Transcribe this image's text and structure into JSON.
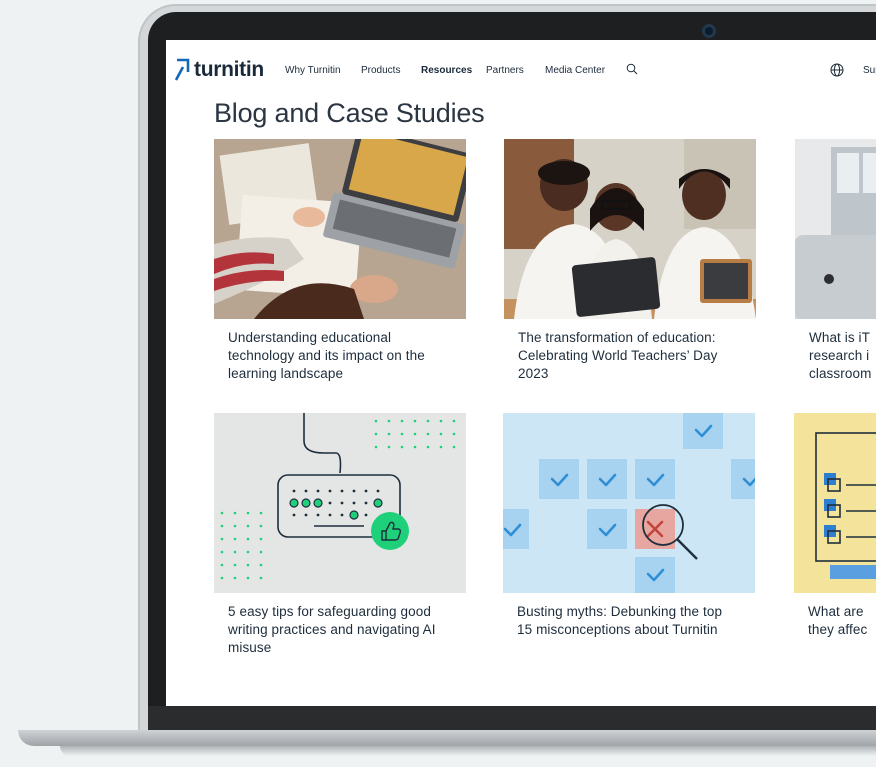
{
  "nav": {
    "logo_text": "turnitin",
    "items": [
      "Why Turnitin",
      "Products",
      "Resources",
      "Partners",
      "Media Center"
    ],
    "active": "Resources",
    "support_label": "Sup"
  },
  "page": {
    "title": "Blog and Case Studies"
  },
  "articles": [
    {
      "title": "Understanding educational technology and its impact on the learning landscape"
    },
    {
      "title": "The transformation of education: Celebrating World Teachers’ Day 2023"
    },
    {
      "title": "What is iT research i classroom"
    },
    {
      "title": "5 easy tips for safeguarding good writing practices and navigating AI misuse"
    },
    {
      "title": "Busting myths: Debunking the top 15 misconceptions about Turnitin"
    },
    {
      "title": "What are they affec"
    }
  ],
  "colors": {
    "text_dark": "#1e2d3c",
    "brand_blue": "#1468b8",
    "accent_green": "#1fd07a",
    "check_blue": "#2f8fd6",
    "tile_blue": "#bfe0f6",
    "error_red": "#e8a6a0",
    "card_gray_bg": "#e3e6e5",
    "card_yellow_bg": "#f4e39a"
  },
  "icons": [
    "search-icon",
    "globe-icon",
    "thumbs-up-icon",
    "checkmark-icon",
    "magnifier-icon",
    "x-mark-icon"
  ]
}
